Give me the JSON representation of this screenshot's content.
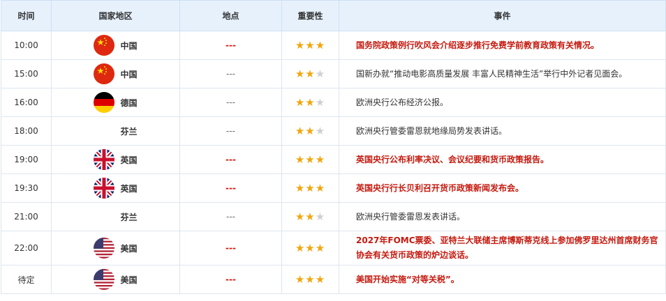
{
  "headers": {
    "time": "时间",
    "country": "国家地区",
    "location": "地点",
    "importance": "重要性",
    "event": "事件"
  },
  "colors": {
    "header_bg": "#e6f1fc",
    "important_text": "#c41a0f",
    "star_on": "#f2a50c",
    "star_off": "#cfcfcf"
  },
  "rows": [
    {
      "time": "10:00",
      "country": "中国",
      "flag": "china-flag-icon",
      "location": "---",
      "stars": 3,
      "event": "国务院政策例行吹风会介绍逐步推行免费学前教育政策有关情况。",
      "important": true
    },
    {
      "time": "15:00",
      "country": "中国",
      "flag": "china-flag-icon",
      "location": "---",
      "stars": 2,
      "event": "国新办就“推动电影高质量发展 丰富人民精神生活”举行中外记者见面会。",
      "important": false
    },
    {
      "time": "16:00",
      "country": "德国",
      "flag": "germany-flag-icon",
      "location": "---",
      "stars": 2,
      "event": "欧洲央行公布经济公报。",
      "important": false
    },
    {
      "time": "18:00",
      "country": "芬兰",
      "flag": "",
      "location": "---",
      "stars": 2,
      "event": "欧洲央行管委雷恩就地缘局势发表讲话。",
      "important": false
    },
    {
      "time": "19:00",
      "country": "英国",
      "flag": "uk-flag-icon",
      "location": "---",
      "stars": 3,
      "event": "英国央行公布利率决议、会议纪要和货币政策报告。",
      "important": true
    },
    {
      "time": "19:30",
      "country": "英国",
      "flag": "uk-flag-icon",
      "location": "---",
      "stars": 3,
      "event": "英国央行行长贝利召开货币政策新闻发布会。",
      "important": true
    },
    {
      "time": "21:00",
      "country": "芬兰",
      "flag": "",
      "location": "---",
      "stars": 2,
      "event": "欧洲央行管委雷恩发表讲话。",
      "important": false
    },
    {
      "time": "22:00",
      "country": "美国",
      "flag": "usa-flag-icon",
      "location": "---",
      "stars": 3,
      "event": "2027年FOMC票委、亚特兰大联储主席博斯蒂克线上参加佛罗里达州首席财务官协会有关货币政策的炉边谈话。",
      "important": true
    },
    {
      "time": "待定",
      "country": "美国",
      "flag": "usa-flag-icon",
      "location": "---",
      "stars": 3,
      "event": "美国开始实施“对等关税”。",
      "important": true
    }
  ]
}
